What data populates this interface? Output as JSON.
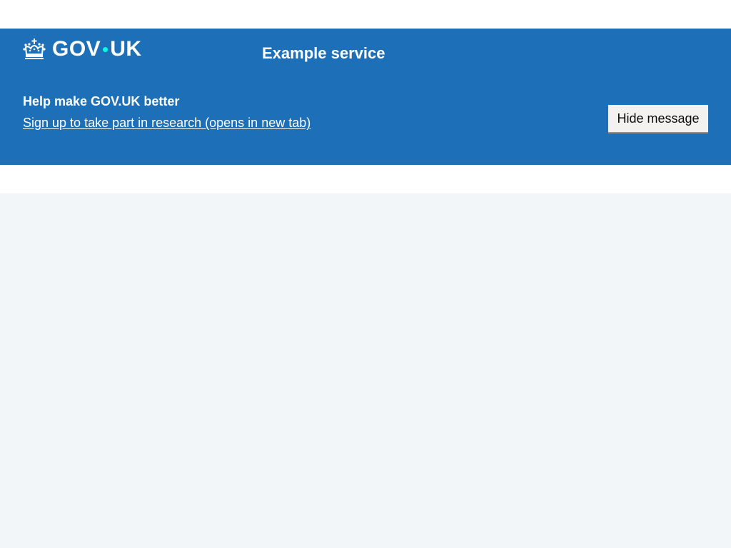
{
  "header": {
    "logo_text_left": "GOV",
    "logo_text_right": "UK",
    "service_name": "Example service"
  },
  "banner": {
    "title": "Help make GOV.UK better",
    "link_text": "Sign up to take part in research (opens in new tab)",
    "hide_button_label": "Hide message"
  },
  "colors": {
    "brand_blue": "#1d70b8",
    "logo_dot": "#00ffe0",
    "button_bg": "#f3f2f1",
    "page_bg": "#f3f6f9"
  },
  "icons": {
    "logo": "crown-icon"
  }
}
